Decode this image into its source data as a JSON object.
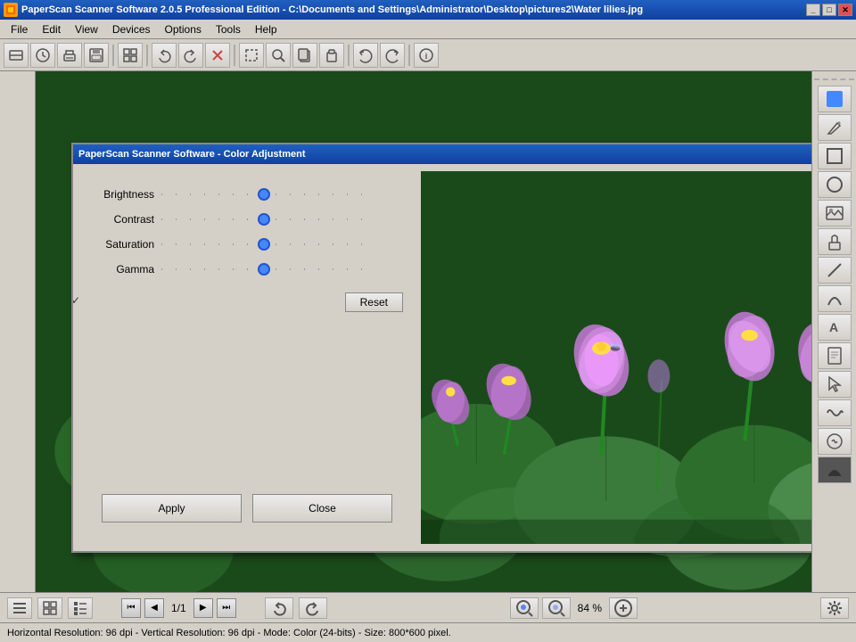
{
  "app": {
    "title": "PaperScan Scanner Software 2.0.5 Professional Edition - C:\\Documents and Settings\\Administrator\\Desktop\\pictures2\\Water lilies.jpg",
    "dialog_title": "PaperScan Scanner Software - Color Adjustment"
  },
  "menu": {
    "items": [
      "File",
      "Edit",
      "View",
      "Devices",
      "Options",
      "Tools",
      "Help"
    ]
  },
  "sliders": {
    "brightness_label": "Brightness",
    "contrast_label": "Contrast",
    "saturation_label": "Saturation",
    "gamma_label": "Gamma",
    "brightness_value": 50,
    "contrast_value": 50,
    "saturation_value": 50,
    "gamma_value": 50
  },
  "buttons": {
    "reset": "Reset",
    "apply": "Apply",
    "close": "Close"
  },
  "status_bar": {
    "text": "Horizontal Resolution: 96 dpi - Vertical Resolution: 96 dpi - Mode: Color (24-bits) - Size: 800*600 pixel."
  },
  "navigation": {
    "page_info": "1/1"
  },
  "zoom": {
    "value": "84 %"
  }
}
